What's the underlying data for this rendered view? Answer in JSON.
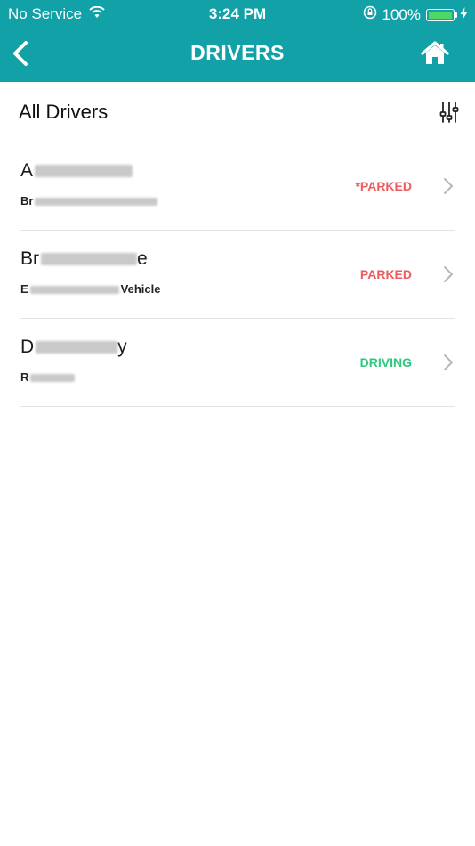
{
  "status_bar": {
    "carrier": "No Service",
    "time": "3:24 PM",
    "battery": "100%",
    "icons": [
      "wifi-icon",
      "orientation-lock-icon",
      "battery-icon",
      "charging-bolt-icon"
    ]
  },
  "nav": {
    "title": "DRIVERS",
    "back_icon": "chevron-left-icon",
    "home_icon": "home-icon"
  },
  "section": {
    "title": "All Drivers",
    "filter_icon": "sliders-icon"
  },
  "drivers": [
    {
      "name": "A",
      "subtitle": "Br",
      "subtitle_tail": "",
      "status": "*PARKED",
      "status_color": "#ee5a5e"
    },
    {
      "name": "Br",
      "name_tail": "e",
      "subtitle": "E",
      "subtitle_tail": "Vehicle",
      "status": "PARKED",
      "status_color": "#ee5a5e"
    },
    {
      "name": "D",
      "name_tail": "y",
      "subtitle": "R",
      "subtitle_tail": "",
      "status": "DRIVING",
      "status_color": "#2fc77e"
    }
  ],
  "colors": {
    "header": "#11a1a7",
    "parked": "#ee5a5e",
    "driving": "#2fc77e"
  }
}
